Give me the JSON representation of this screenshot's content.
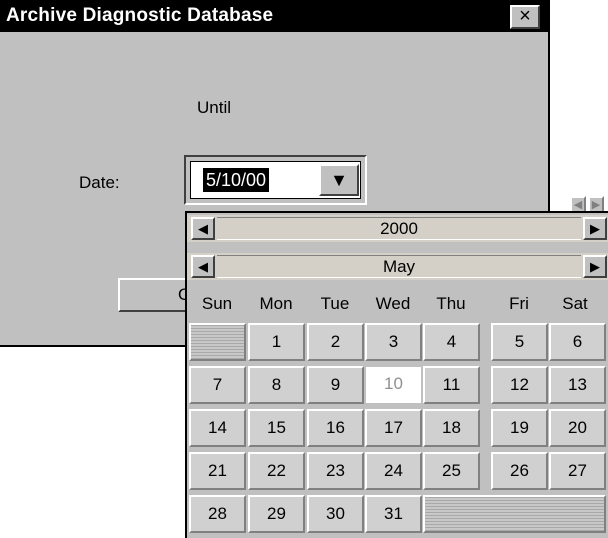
{
  "dialog": {
    "title": "Archive Diagnostic Database",
    "close_icon": "×",
    "until_label": "Until",
    "date_label": "Date:",
    "date_value": "5/10/00",
    "dropdown_icon": "▼",
    "ok_partial": "O"
  },
  "calendar": {
    "year": "2000",
    "month": "May",
    "prev_icon": "◀",
    "next_icon": "▶",
    "weekdays": [
      "Sun",
      "Mon",
      "Tue",
      "Wed",
      "Thu",
      "Fri",
      "Sat"
    ],
    "selected_day": "10",
    "days": [
      "1",
      "2",
      "3",
      "4",
      "5",
      "6",
      "7",
      "8",
      "9",
      "10",
      "11",
      "12",
      "13",
      "14",
      "15",
      "16",
      "17",
      "18",
      "19",
      "20",
      "21",
      "22",
      "23",
      "24",
      "25",
      "26",
      "27",
      "28",
      "29",
      "30",
      "31"
    ]
  }
}
